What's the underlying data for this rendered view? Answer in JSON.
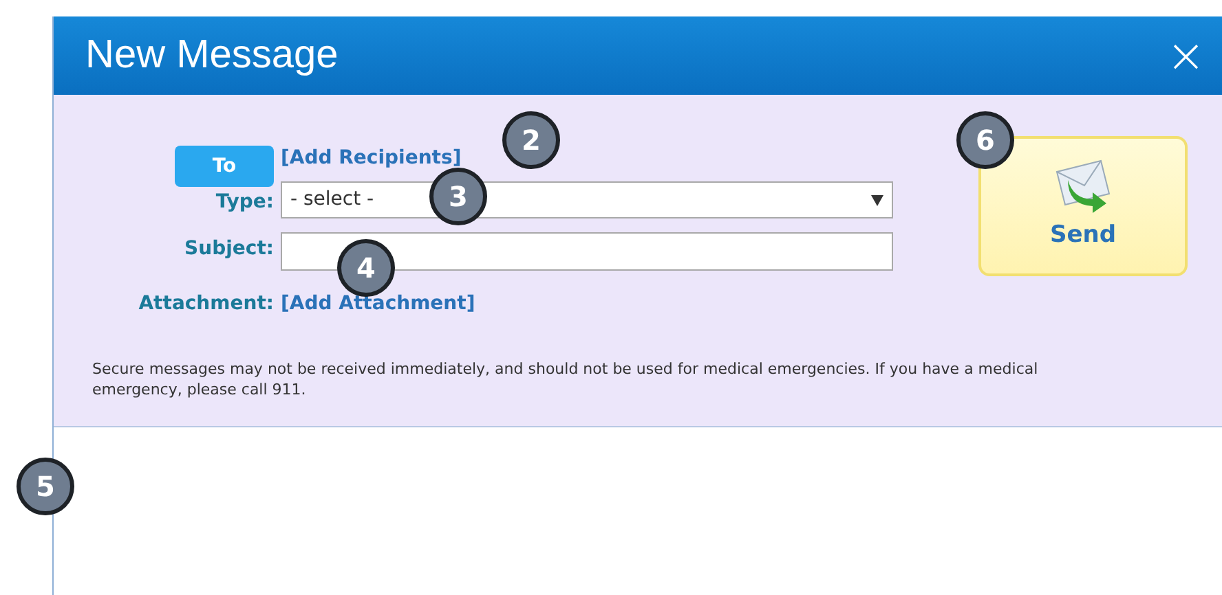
{
  "window": {
    "title": "New Message",
    "close": "×"
  },
  "form": {
    "to_button": "To",
    "add_recipients": "[Add Recipients]",
    "type_label": "Type:",
    "type_value": "- select -",
    "subject_label": "Subject:",
    "attachment_label": "Attachment:",
    "add_attachment": "[Add Attachment]"
  },
  "send_button": "Send",
  "notice": "Secure messages may not be received immediately, and should not be used for medical emergencies. If you have a medical emergency, please call 911.",
  "callouts": [
    {
      "number": "2"
    },
    {
      "number": "3"
    },
    {
      "number": "4"
    },
    {
      "number": "5"
    },
    {
      "number": "6"
    }
  ]
}
